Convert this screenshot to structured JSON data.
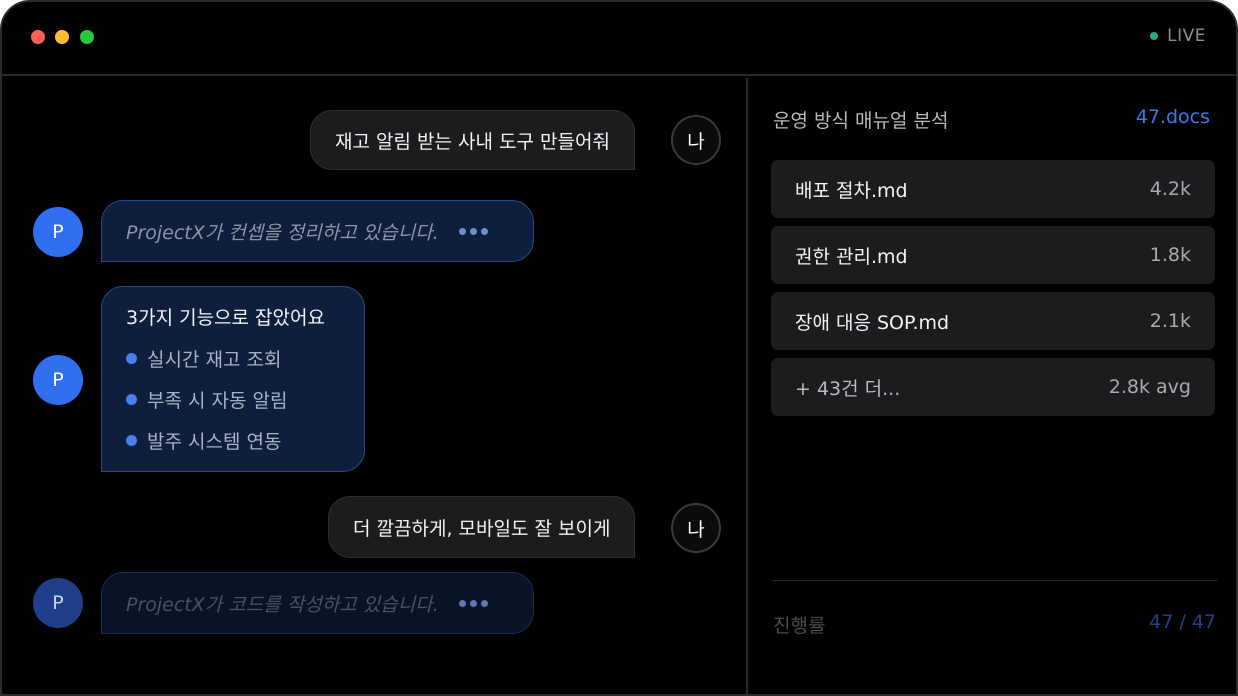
{
  "status": {
    "live_label": "LIVE"
  },
  "chat": {
    "user_label": "나",
    "bot_label": "P",
    "msg1": "재고 알림 받는 사내 도구 만들어줘",
    "typing1": "ProjectX가 컨셉을 정리하고 있습니다.",
    "features": {
      "title": "3가지 기능으로 잡았어요",
      "items": [
        "실시간 재고 조회",
        "부족 시 자동 알림",
        "발주 시스템 연동"
      ]
    },
    "msg2": "더 깔끔하게, 모바일도 잘 보이게",
    "typing2": "ProjectX가 코드를 작성하고 있습니다."
  },
  "side": {
    "title": "운영 방식 매뉴얼 분석",
    "count": "47.docs",
    "files": [
      {
        "name": "배포 절차.md",
        "size": "4.2k"
      },
      {
        "name": "권한 관리.md",
        "size": "1.8k"
      },
      {
        "name": "장애 대응 SOP.md",
        "size": "2.1k"
      },
      {
        "name": "+ 43건 더...",
        "size": "2.8k avg"
      }
    ],
    "progress_label": "진행률",
    "progress_value": "47 / 47"
  },
  "colors": {
    "accent": "#3a78f2",
    "live": "#34d399",
    "bot_bubble": "#0e1f3d"
  }
}
